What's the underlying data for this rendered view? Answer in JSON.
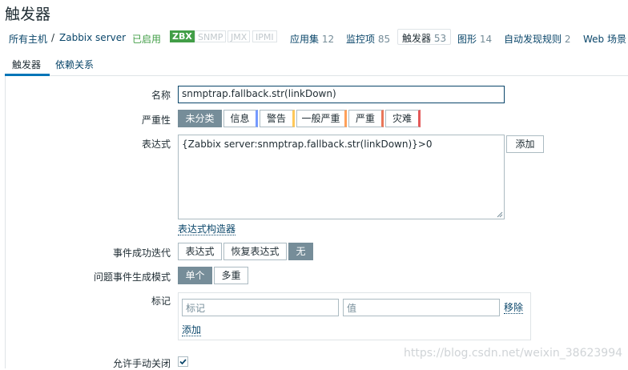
{
  "page": {
    "title": "触发器"
  },
  "nav": {
    "all_hosts": "所有主机",
    "separator": "/",
    "host": "Zabbix server",
    "status": "已启用",
    "badges": {
      "zbx": "ZBX",
      "snmp": "SNMP",
      "jmx": "JMX",
      "ipmi": "IPMI"
    },
    "apps": {
      "label": "应用集",
      "count": "12"
    },
    "items": {
      "label": "监控项",
      "count": "85"
    },
    "triggers": {
      "label": "触发器",
      "count": "53"
    },
    "graphs": {
      "label": "图形",
      "count": "14"
    },
    "discovery": {
      "label": "自动发现规则",
      "count": "2"
    },
    "web": {
      "label": "Web 场景"
    }
  },
  "tabs": {
    "trigger": "触发器",
    "dependencies": "依赖关系"
  },
  "form": {
    "name": {
      "label": "名称",
      "value": "snmptrap.fallback.str(linkDown)"
    },
    "severity": {
      "label": "严重性",
      "options": [
        "未分类",
        "信息",
        "警告",
        "一般严重",
        "严重",
        "灾难"
      ],
      "selected": "未分类",
      "colors": [
        "#97aab3",
        "#7499ff",
        "#ffc859",
        "#ffa059",
        "#e97659",
        "#e45959"
      ]
    },
    "expression": {
      "label": "表达式",
      "value": "{Zabbix server:snmptrap.fallback.str(linkDown)}>0",
      "add_button": "添加",
      "constructor_link": "表达式构造器"
    },
    "ok_event": {
      "label": "事件成功迭代",
      "options": [
        "表达式",
        "恢复表达式",
        "无"
      ],
      "selected": "无"
    },
    "problem_mode": {
      "label": "问题事件生成模式",
      "options": [
        "单个",
        "多重"
      ],
      "selected": "单个"
    },
    "tags": {
      "label": "标记",
      "tag_placeholder": "标记",
      "value_placeholder": "值",
      "remove_link": "移除",
      "add_link": "添加"
    },
    "manual_close": {
      "label": "允许手动关闭",
      "checked": true
    }
  },
  "watermark": "https://blog.csdn.net/weixin_38623994"
}
